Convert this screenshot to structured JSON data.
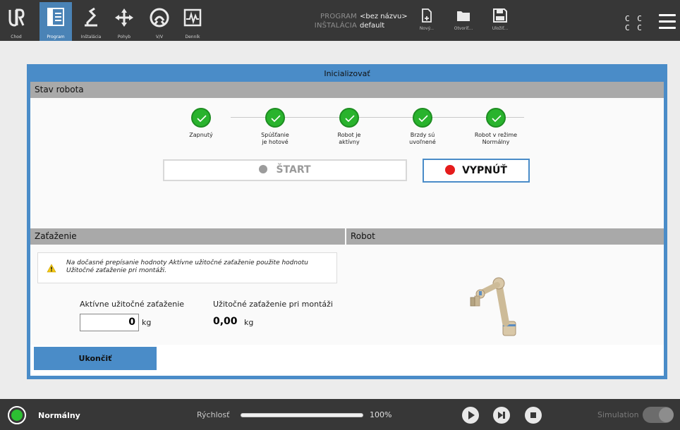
{
  "nav": {
    "items": [
      {
        "label": "Chod",
        "icon": "ur-logo-icon"
      },
      {
        "label": "Program",
        "icon": "program-icon",
        "active": true
      },
      {
        "label": "Inštalácia",
        "icon": "installation-icon"
      },
      {
        "label": "Pohyb",
        "icon": "move-icon"
      },
      {
        "label": "V/V",
        "icon": "io-icon"
      },
      {
        "label": "Denník",
        "icon": "log-icon"
      }
    ]
  },
  "program_info": {
    "program_key": "PROGRAM",
    "program_value": "<bez názvu>",
    "installation_key": "INŠTALÁCIA",
    "installation_value": "default"
  },
  "file_buttons": {
    "new": "Nový...",
    "open": "Otvoriť...",
    "save": "Uložiť..."
  },
  "cc": {
    "row1": "C C",
    "row2": "C C"
  },
  "dialog": {
    "title": "Inicializovať",
    "robot_state": {
      "heading": "Stav robota",
      "states": [
        {
          "label": "Zapnutý",
          "done": true
        },
        {
          "label": "Spúšťanie\nje hotové",
          "done": true
        },
        {
          "label": "Robot je\naktívny",
          "done": true
        },
        {
          "label": "Brzdy sú\nuvoľnené",
          "done": true
        },
        {
          "label": "Robot v režime\nNormálny",
          "done": true
        }
      ],
      "start_label": "ŠTART",
      "off_label": "VYPNÚŤ"
    },
    "payload": {
      "heading": "Zaťaženie",
      "note": "Na dočasné prepísanie hodnoty Aktívne užitočné zaťaženie použite hodnotu Užitočné zaťaženie pri montáži.",
      "active_label": "Aktívne užitočné zaťaženie",
      "active_value": "0",
      "active_unit": "kg",
      "mount_label": "Užitočné zaťaženie pri montáži",
      "mount_value": "0,00",
      "mount_unit": "kg"
    },
    "robot": {
      "heading": "Robot"
    },
    "exit_label": "Ukončiť"
  },
  "footer": {
    "status": "Normálny",
    "status_color": "#2cbf32",
    "speed_label": "Rýchlosť",
    "speed_value": "100%",
    "speed_fraction": 1.0,
    "simulation_label": "Simulation",
    "simulation_on": false
  },
  "colors": {
    "accent": "#4a8cc8",
    "ok_green": "#29b32d",
    "stop_red": "#e51c1c",
    "bar_dark": "#373737"
  }
}
